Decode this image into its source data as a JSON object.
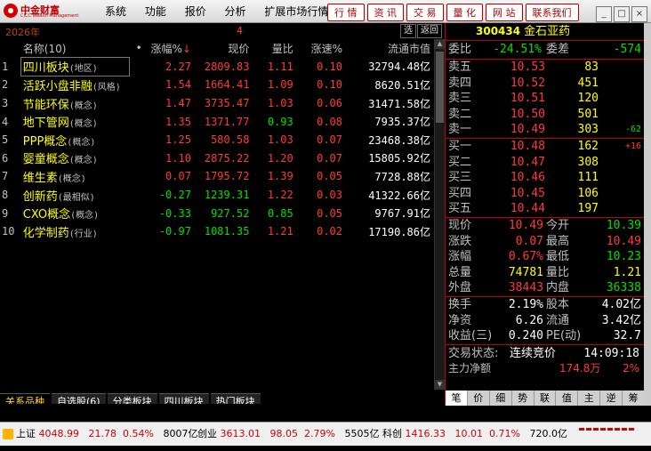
{
  "app": {
    "logo_cn": "中金财富",
    "logo_en": "CICC Wealth Management",
    "menus": [
      "系统",
      "功能",
      "报价",
      "分析",
      "扩展市场行情"
    ],
    "quick_buttons": [
      "行 情",
      "资 讯",
      "交 易",
      "量 化",
      "网 站",
      "联系我们"
    ],
    "window_controls": [
      "min",
      "max",
      "close"
    ]
  },
  "toolbar": {
    "date": "2026年",
    "marker": "4",
    "select_label": "选",
    "back_label": "返回"
  },
  "table": {
    "headers": [
      "",
      "名称(10)",
      "•",
      "涨幅%",
      "现价",
      "量比",
      "涨速%",
      "流通市值"
    ],
    "sort_indicator": "↓",
    "rows": [
      {
        "idx": "1",
        "name": "四川板块",
        "tag": "(地区)",
        "chg": "2.27",
        "price": "2809.83",
        "vr": "1.11",
        "spd": "0.10",
        "cap": "32794.48亿",
        "color": "red"
      },
      {
        "idx": "2",
        "name": "活跃小盘非融",
        "tag": "(风格)",
        "chg": "1.54",
        "price": "1664.41",
        "vr": "1.09",
        "spd": "0.10",
        "cap": "8620.51亿",
        "color": "red"
      },
      {
        "idx": "3",
        "name": "节能环保",
        "tag": "(概念)",
        "chg": "1.47",
        "price": "3735.47",
        "vr": "1.03",
        "spd": "0.06",
        "cap": "31471.58亿",
        "color": "red"
      },
      {
        "idx": "4",
        "name": "地下管网",
        "tag": "(概念)",
        "chg": "1.35",
        "price": "1371.77",
        "vr": "0.93",
        "spd": "0.08",
        "cap": "7935.37亿",
        "color": "red",
        "vr_green": true
      },
      {
        "idx": "5",
        "name": "PPP概念",
        "tag": "(概念)",
        "chg": "1.25",
        "price": "580.58",
        "vr": "1.03",
        "spd": "0.07",
        "cap": "23468.38亿",
        "color": "red"
      },
      {
        "idx": "6",
        "name": "婴童概念",
        "tag": "(概念)",
        "chg": "1.10",
        "price": "2875.22",
        "vr": "1.20",
        "spd": "0.07",
        "cap": "15805.92亿",
        "color": "red"
      },
      {
        "idx": "7",
        "name": "维生素",
        "tag": "(概念)",
        "chg": "0.07",
        "price": "1795.72",
        "vr": "1.39",
        "spd": "0.05",
        "cap": "7728.88亿",
        "color": "red"
      },
      {
        "idx": "8",
        "name": "创新药",
        "tag": "(最相似)",
        "chg": "-0.27",
        "price": "1239.31",
        "vr": "1.22",
        "spd": "0.03",
        "cap": "41322.66亿",
        "color": "green"
      },
      {
        "idx": "9",
        "name": "CXO概念",
        "tag": "(概念)",
        "chg": "-0.33",
        "price": "927.52",
        "vr": "0.85",
        "spd": "0.05",
        "cap": "9767.91亿",
        "color": "green",
        "vr_green": true
      },
      {
        "idx": "10",
        "name": "化学制药",
        "tag": "(行业)",
        "chg": "-0.97",
        "price": "1081.35",
        "vr": "1.21",
        "spd": "0.02",
        "cap": "17190.86亿",
        "color": "green"
      }
    ]
  },
  "bottom_tabs": [
    "关系品种",
    "自选股(6)",
    "分类板块",
    "四川板块",
    "热门板块"
  ],
  "stock": {
    "code": "300434",
    "name": "金石亚药",
    "weibi_label": "委比",
    "weibi": "-24.51%",
    "weicha_label": "委差",
    "weicha": "-574",
    "sells": [
      {
        "label": "卖五",
        "price": "10.53",
        "vol": "83",
        "delta": ""
      },
      {
        "label": "卖四",
        "price": "10.52",
        "vol": "451",
        "delta": ""
      },
      {
        "label": "卖三",
        "price": "10.51",
        "vol": "120",
        "delta": ""
      },
      {
        "label": "卖二",
        "price": "10.50",
        "vol": "501",
        "delta": ""
      },
      {
        "label": "卖一",
        "price": "10.49",
        "vol": "303",
        "delta": "-62"
      }
    ],
    "buys": [
      {
        "label": "买一",
        "price": "10.48",
        "vol": "162",
        "delta": "+16"
      },
      {
        "label": "买二",
        "price": "10.47",
        "vol": "308",
        "delta": ""
      },
      {
        "label": "买三",
        "price": "10.46",
        "vol": "111",
        "delta": ""
      },
      {
        "label": "买四",
        "price": "10.45",
        "vol": "106",
        "delta": ""
      },
      {
        "label": "买五",
        "price": "10.44",
        "vol": "197",
        "delta": ""
      }
    ],
    "stats1": [
      {
        "l1": "现价",
        "v1": "10.49",
        "c1": "red",
        "l2": "今开",
        "v2": "10.39",
        "c2": "green"
      },
      {
        "l1": "涨跌",
        "v1": "0.07",
        "c1": "red",
        "l2": "最高",
        "v2": "10.49",
        "c2": "red"
      },
      {
        "l1": "涨幅",
        "v1": "0.67%",
        "c1": "red",
        "l2": "最低",
        "v2": "10.23",
        "c2": "green"
      },
      {
        "l1": "总量",
        "v1": "74781",
        "c1": "yel",
        "l2": "量比",
        "v2": "1.21",
        "c2": "yel"
      },
      {
        "l1": "外盘",
        "v1": "38443",
        "c1": "red",
        "l2": "内盘",
        "v2": "36338",
        "c2": "green"
      }
    ],
    "stats2": [
      {
        "l1": "换手",
        "v1": "2.19%",
        "c1": "white",
        "l2": "股本",
        "v2": "4.02亿",
        "c2": "white"
      },
      {
        "l1": "净资",
        "v1": "6.26",
        "c1": "white",
        "l2": "流通",
        "v2": "3.42亿",
        "c2": "white"
      },
      {
        "l1": "收益(三)",
        "v1": "0.240",
        "c1": "white",
        "l2": "PE(动)",
        "v2": "32.7",
        "c2": "white"
      }
    ],
    "trade_status_label": "交易状态:",
    "trade_status": "连续竞价",
    "trade_time": "14:09:18",
    "flow_label": "主力净额",
    "flow_value": "174.8万",
    "flow_pct": "2%",
    "tabs": [
      "笔",
      "价",
      "细",
      "势",
      "联",
      "值",
      "主",
      "逆",
      "筹"
    ]
  },
  "ticker": [
    {
      "name": "上证",
      "price": "4048.99",
      "chg": "21.78",
      "pct": "0.54%",
      "amt": "8007亿"
    },
    {
      "name": "创业",
      "price": "3613.01",
      "chg": "98.05",
      "pct": "2.79%",
      "amt": "5505亿"
    },
    {
      "name": "科创",
      "price": "1416.33",
      "chg": "10.01",
      "pct": "0.71%",
      "amt": "720.0亿"
    }
  ]
}
